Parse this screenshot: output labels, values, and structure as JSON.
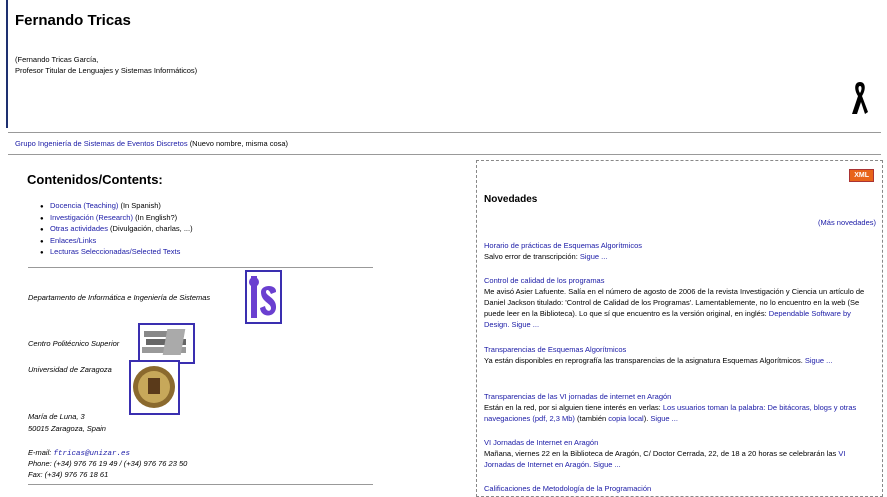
{
  "header": {
    "name": "Fernando Tricas",
    "subtitle_line1": "(Fernando Tricas García,",
    "subtitle_line2": "Profesor Titular de Lenguajes y Sistemas Informáticos)"
  },
  "group": {
    "link": "Grupo Ingeniería de Sistemas de Eventos Discretos",
    "note": "(Nuevo nombre, misma cosa)"
  },
  "contents": {
    "title": "Contenidos/Contents:",
    "items": [
      {
        "link": "Docencia (Teaching)",
        "note": "(In Spanish)"
      },
      {
        "link": "Investigación (Research)",
        "note": "(In English?)"
      },
      {
        "link": "Otras actividades",
        "note": "(Divulgación, charlas, ...)"
      },
      {
        "link": "Enlaces/Links",
        "note": ""
      },
      {
        "link": "Lecturas Seleccionadas/Selected Texts",
        "note": ""
      }
    ]
  },
  "affiliation": {
    "department": "Departamento de Informática e Ingeniería de Sistemas",
    "center": "Centro Politécnico Superior",
    "university": "Universidad de Zaragoza",
    "address1": "María de Luna, 3",
    "address2": "50015 Zaragoza, Spain",
    "email_label": "E-mail:",
    "email": "ftricas@unizar.es",
    "phone": "Phone: (+34) 976 76 19 49 / (+34) 976 76 23 50",
    "fax": "Fax: (+34) 976 76 18 61"
  },
  "news": {
    "xml_label": "XML",
    "title": "Novedades",
    "more": "(Más novedades)",
    "items": [
      {
        "title": "Horario de prácticas de Esquemas Algorítmicos",
        "body": "Salvo error de transcripción:",
        "link": "Sigue ..."
      },
      {
        "title": "Control de calidad de los programas",
        "body": "Me avisó Asier Lafuente. Salía en el número de agosto de 2006 de la revista Investigación y Ciencia un artículo de Daniel Jackson titulado: 'Control de Calidad de los Programas'. Lamentablemente, no lo encuentro en la web (Se puede leer en la Biblioteca). Lo que sí que encuentro es la versión original, en inglés:",
        "link": "Dependable Software by Design. Sigue ..."
      },
      {
        "title": "Transparencias de Esquemas Algorítmicos",
        "body": "Ya están disponibles en reprografía las transparencias de la asignatura Esquemas Algorítmicos.",
        "link": "Sigue ..."
      },
      {
        "title": "Transparencias de las VI jornadas de internet en Aragón",
        "body": "Están en la red, por si alguien tiene interés en verlas:",
        "link": "Los usuarios toman la palabra: De bitácoras, blogs y otras navegaciones (pdf, 2,3 Mb)",
        "body2": "(también",
        "link2": "copia local",
        "body3": ").",
        "link3": "Sigue ..."
      },
      {
        "title": "VI Jornadas de Internet en Aragón",
        "body": "Mañana, viernes 22 en la Biblioteca de Aragón, C/ Doctor Cerrada, 22, de 18 a 20 horas se celebrarán las",
        "link": "VI Jornadas de Internet en Aragón. Sigue ..."
      },
      {
        "title": "Calificaciones de Metodología de la Programación"
      }
    ]
  },
  "colors": {
    "link": "#1a1aa6",
    "xml": "#e8641a",
    "bar": "#1e3070"
  }
}
